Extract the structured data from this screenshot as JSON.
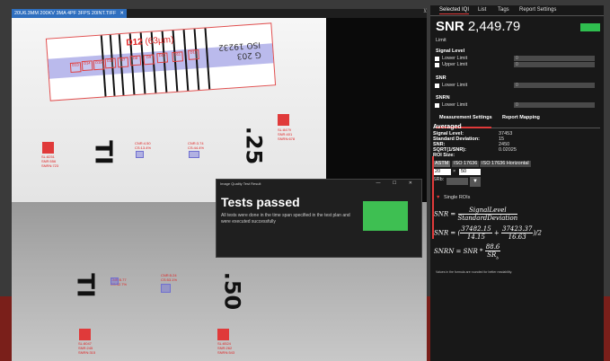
{
  "image_panel": {
    "tab_label": "20U6.3MM 200KV 3MA 4PF 3FPS 20INT.TIFF",
    "close_glyph": "✕",
    "iqi_wire": "D12",
    "iqi_wire_size": "(63µm)",
    "iqi_stamp_line1": "G 203",
    "iqi_stamp_line2": "ISO 19232",
    "wire_labels": [
      "D13",
      "D14",
      "D15",
      "D16",
      "D7",
      "D8",
      "D9",
      "D10",
      "D11",
      "D12"
    ],
    "marks": [
      "TI",
      ".25",
      "TI",
      ".50"
    ],
    "roi_texts": [
      "SL:8479\nSNR:401\nSNRN:678",
      "SL:8251\nSNR:556\nSNRN:723",
      "CNR:4.50\nCS:13.4%",
      "CNR:3.74\nCS:44.4%",
      "CNR:5.77\nCS:32.7%",
      "CNR:5.24\nCS:53.1%",
      "SL:8047\nSNR:245\nSNRN:315",
      "SL:6524\nSNR:262\nSNRN:543"
    ]
  },
  "dialog": {
    "title": "Image Quality Test Result",
    "controls": "—  ☐  ✕",
    "heading": "Tests passed",
    "body": "All tests were done in the time span specified in the test plan and were executed successfully",
    "status_color": "#3ebf52"
  },
  "panel": {
    "pin_glyph": "⊻",
    "tabs": [
      "Selected IQI",
      "List",
      "Tags",
      "Report Settings"
    ],
    "snr_label": "SNR",
    "snr_value": "2,449.79",
    "status_color": "#2fbe4f",
    "limit_heading": "Limit",
    "signal_level": {
      "heading": "Signal Level",
      "lower": "Lower Limit",
      "upper": "Upper Limit",
      "lower_value": "0",
      "upper_value": "0"
    },
    "snr_limit": {
      "heading": "SNR",
      "lower": "Lower Limit",
      "value": "0"
    },
    "snrn_limit": {
      "heading": "SNRN",
      "lower": "Lower Limit",
      "value": "0"
    },
    "measure_tabs": [
      "Measurement Settings",
      "Report Mapping"
    ],
    "averaged": {
      "heading": "Averaged",
      "rows": [
        {
          "label": "Signal Level:",
          "value": "37453"
        },
        {
          "label": "Standard Deviation:",
          "value": "15"
        },
        {
          "label": "SNR:",
          "value": "2450"
        },
        {
          "label": "SQRT(1/SNR):",
          "value": "0.02025"
        }
      ],
      "roi_size": "ROI Size:"
    },
    "astm_options": [
      "ASTM",
      "ISO 17636",
      "ISO 17636 Horizontal"
    ],
    "roi_w": "20",
    "roi_h": "50",
    "srb_label": "SRb:",
    "single_rois": "Single ROIs",
    "formula": {
      "snr_lhs": "SNR =",
      "snr_num": "SignalLevel",
      "snr_den": "StandardDeviation",
      "calc_lhs": "SNR = (",
      "calc1_num": "37482.15",
      "calc1_den": "14.15",
      "calc_plus": "+",
      "calc2_num": "37423.37",
      "calc2_den": "16.63",
      "calc_tail": ")/2",
      "snrn_lhs": "SNRN = SNR *",
      "snrn_num": "88.6",
      "snrn_den": "SR",
      "snrn_sub": "b"
    },
    "note": "Values in the formula are rounded for better readability."
  }
}
